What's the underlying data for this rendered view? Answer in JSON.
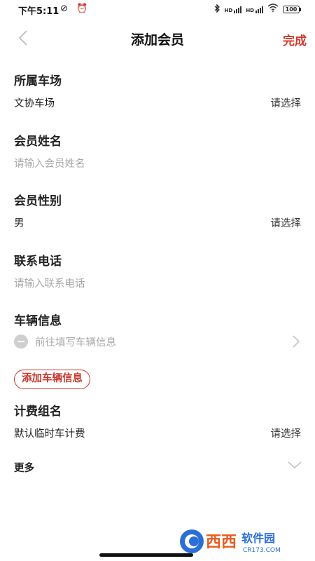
{
  "status_bar": {
    "time": "下午5:11",
    "left_icons": "⊘ ⏰",
    "sig1_label": "HD",
    "sig2_label": "HD",
    "battery": "100"
  },
  "nav": {
    "title": "添加会员",
    "done_label": "完成"
  },
  "form": {
    "lot": {
      "label": "所属车场",
      "value": "文协车场",
      "action": "请选择"
    },
    "name": {
      "label": "会员姓名",
      "placeholder": "请输入会员姓名"
    },
    "gender": {
      "label": "会员性别",
      "value": "男",
      "action": "请选择"
    },
    "phone": {
      "label": "联系电话",
      "placeholder": "请输入联系电话"
    },
    "vehicle": {
      "label": "车辆信息",
      "placeholder": "前往填写车辆信息"
    },
    "add_vehicle_label": "添加车辆信息",
    "billing": {
      "label": "计费组名",
      "value": "默认临时车计费",
      "action": "请选择"
    },
    "more_label": "更多"
  },
  "watermark": {
    "brand": "西西",
    "brand_sub": "软件园",
    "domain": "CR173.COM"
  },
  "colors": {
    "accent": "#d03a2f",
    "placeholder": "#a8a8a8",
    "text": "#222222"
  }
}
